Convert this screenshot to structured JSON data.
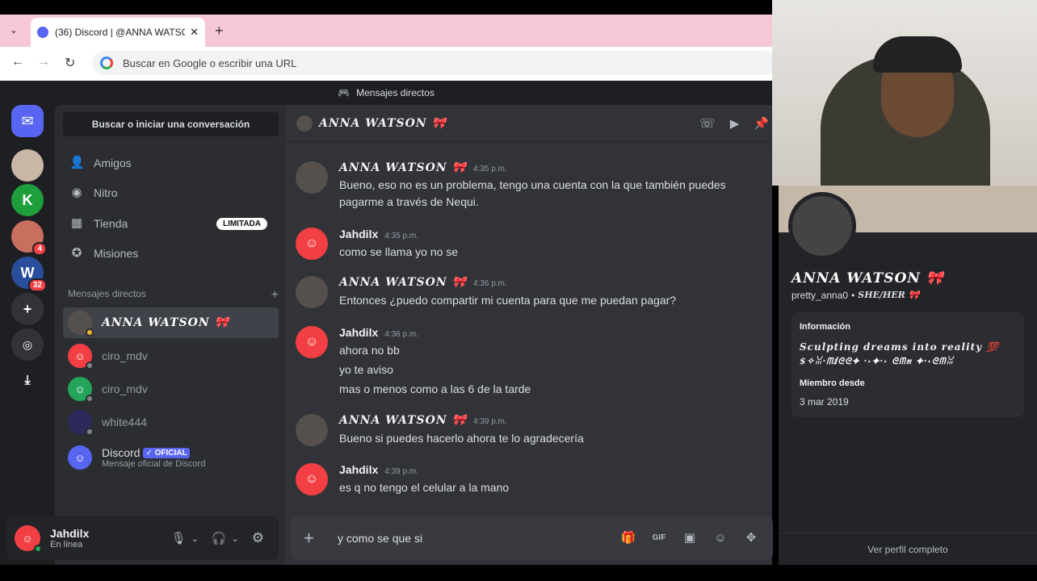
{
  "browser": {
    "tab_title": "(36) Discord | @ANNA WATSON",
    "tab_close": "✕",
    "new_tab": "+",
    "omnibox_placeholder": "Buscar en Google o escribir una URL"
  },
  "window": {
    "title": "Mensajes directos"
  },
  "guilds": [
    {
      "name": "home",
      "badge": ""
    },
    {
      "name": "server-1",
      "badge": ""
    },
    {
      "name": "server-2",
      "badge": ""
    },
    {
      "name": "server-3",
      "badge": "4"
    },
    {
      "name": "server-4",
      "badge": "32"
    }
  ],
  "sidebar": {
    "search_label": "Buscar o iniciar una conversación",
    "nav": [
      {
        "label": "Amigos",
        "icon": "friends-icon"
      },
      {
        "label": "Nitro",
        "icon": "nitro-icon"
      },
      {
        "label": "Tienda",
        "icon": "shop-icon",
        "pill": "LIMITADA"
      },
      {
        "label": "Misiones",
        "icon": "quests-icon"
      }
    ],
    "dm_header": "Mensajes directos",
    "dm_add": "+",
    "dms": [
      {
        "name": "ANNA WATSON 🎀",
        "active": true
      },
      {
        "name": "ciro_mdv"
      },
      {
        "name": "ciro_mdv"
      },
      {
        "name": "white444"
      },
      {
        "name": "Discord",
        "badge": "✓ OFICIAL",
        "sub": "Mensaje oficial de Discord"
      }
    ]
  },
  "user": {
    "name": "Jahdilx",
    "status": "En línea"
  },
  "chat": {
    "header_name": "ANNA WATSON 🎀",
    "messages": [
      {
        "author": "ANNA WATSON 🎀",
        "time": "4:35 p.m.",
        "lines": [
          "Bueno, eso no es un problema, tengo una cuenta con la que también puedes",
          "pagarme a través de Nequi."
        ]
      },
      {
        "author": "Jahdilx",
        "time": "4:35 p.m.",
        "lines": [
          "como se llama yo no se"
        ]
      },
      {
        "author": "ANNA WATSON 🎀",
        "time": "4:36 p.m.",
        "lines": [
          "Entonces ¿puedo compartir mi cuenta para que me puedan pagar?"
        ]
      },
      {
        "author": "Jahdilx",
        "time": "4:36 p.m.",
        "lines": [
          "ahora no bb",
          "yo te aviso",
          "mas o menos como a las 6 de la tarde"
        ]
      },
      {
        "author": "ANNA WATSON 🎀",
        "time": "4:39 p.m.",
        "lines": [
          "Bueno si puedes hacerlo ahora te lo agradecería"
        ]
      },
      {
        "author": "Jahdilx",
        "time": "4:39 p.m.",
        "lines": [
          "es q no tengo el celular a la mano"
        ]
      }
    ],
    "composer_value": "y como se que si"
  },
  "profile": {
    "display_name": "ANNA WATSON 🎀",
    "username": "pretty_anna0",
    "pronouns": "SHE/HER 🎀",
    "info_label": "Información",
    "bio_1": "Sculpting dreams into reality 💯",
    "bio_2": "$✧ꈍ·ᗰⅈᘓᘓ✦ ·˖✦·˖ ᘓᗰ೫ ✦·˖ᘓᗰꈍ",
    "member_since_label": "Miembro desde",
    "member_since": "3 mar 2019",
    "view_full": "Ver perfil completo"
  },
  "colors": {
    "accent": "#5865f2",
    "danger": "#f23f43",
    "online": "#23a55a"
  }
}
